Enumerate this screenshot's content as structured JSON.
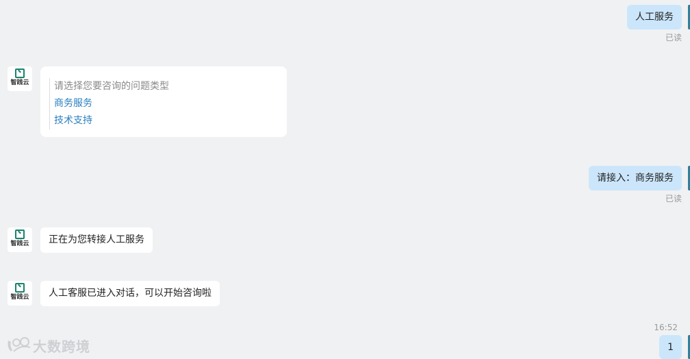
{
  "messages": {
    "user_1": {
      "text": "人工服务",
      "status": "已读"
    },
    "bot_menu": {
      "avatar_text": "智践云",
      "prompt": "请选择您要咨询的问题类型",
      "options": [
        "商务服务",
        "技术支持"
      ]
    },
    "user_2": {
      "text": "请接入：商务服务",
      "status": "已读"
    },
    "bot_2": {
      "avatar_text": "智践云",
      "text": "正在为您转接人工服务"
    },
    "bot_3": {
      "avatar_text": "智践云",
      "text": "人工客服已进入对话，可以开始咨询啦"
    },
    "timestamp": "16:52",
    "user_3": {
      "text": "1"
    }
  },
  "watermark": {
    "text": "大数跨境"
  },
  "colors": {
    "background": "#f0f1f3",
    "user_bubble": "#cbe6fb",
    "bot_bubble": "#ffffff",
    "link": "#2a7fc0",
    "brand": "#17826d"
  }
}
